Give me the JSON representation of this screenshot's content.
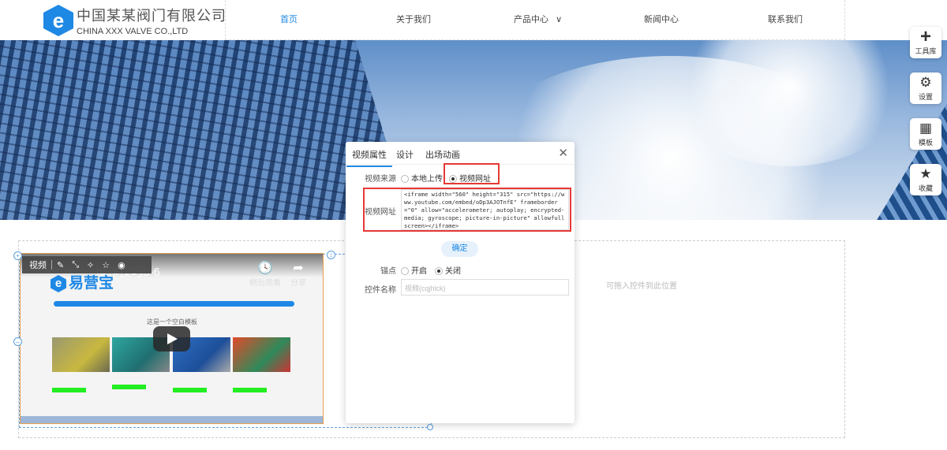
{
  "header": {
    "logo_mark": "e",
    "company_cn": "中国某某阀门有限公司",
    "company_en": "CHINA XXX VALVE CO.,LTD",
    "nav": [
      {
        "label": "首页"
      },
      {
        "label": "关于我们"
      },
      {
        "label": "产品中心"
      },
      {
        "label": "新闻中心"
      },
      {
        "label": "联系我们"
      }
    ],
    "dropdown_glyph": "∨"
  },
  "side_tools": [
    {
      "icon": "plus-icon",
      "glyph": "+",
      "label": "工具库"
    },
    {
      "icon": "gears-icon",
      "glyph": "⚙",
      "label": "设置"
    },
    {
      "icon": "template-grid-icon",
      "glyph": "▦",
      "label": "模板"
    },
    {
      "icon": "star-icon",
      "glyph": "★",
      "label": "收藏"
    }
  ],
  "canvas": {
    "drop_hint": "可拖入控件到此位置"
  },
  "video_toolbar": {
    "label": "视频",
    "icons": [
      "edit-icon",
      "resize-icon",
      "magic-icon",
      "star-icon",
      "eye-icon"
    ]
  },
  "video": {
    "title": "操作技巧5-6",
    "brand": "易营宝",
    "watch_later": "稍后观看",
    "share": "分享",
    "heading": "这是一个空白模板"
  },
  "panel": {
    "tabs": [
      {
        "label": "视频属性"
      },
      {
        "label": "设计"
      },
      {
        "label": "出场动画"
      }
    ],
    "close": "✕",
    "source_label": "视频来源",
    "source_options": [
      {
        "label": "本地上传",
        "selected": false
      },
      {
        "label": "视频网址",
        "selected": true
      }
    ],
    "url_label": "视频网址",
    "url_value": "<iframe width=\"560\" height=\"315\" src=\"https://www.youtube.com/embed/oDp3AJOTnfE\" frameborder=\"0\" allow=\"accelerometer; autoplay; encrypted-media; gyroscope; picture-in-picture\" allowfullscreen></iframe>",
    "confirm": "确定",
    "anchor_label": "锚点",
    "anchor_options": [
      {
        "label": "开启",
        "selected": false
      },
      {
        "label": "关闭",
        "selected": true
      }
    ],
    "name_label": "控件名称",
    "name_placeholder": "视频(cqjhlck)"
  },
  "colors": {
    "accent": "#1e88e5",
    "highlight": "#e53935"
  }
}
